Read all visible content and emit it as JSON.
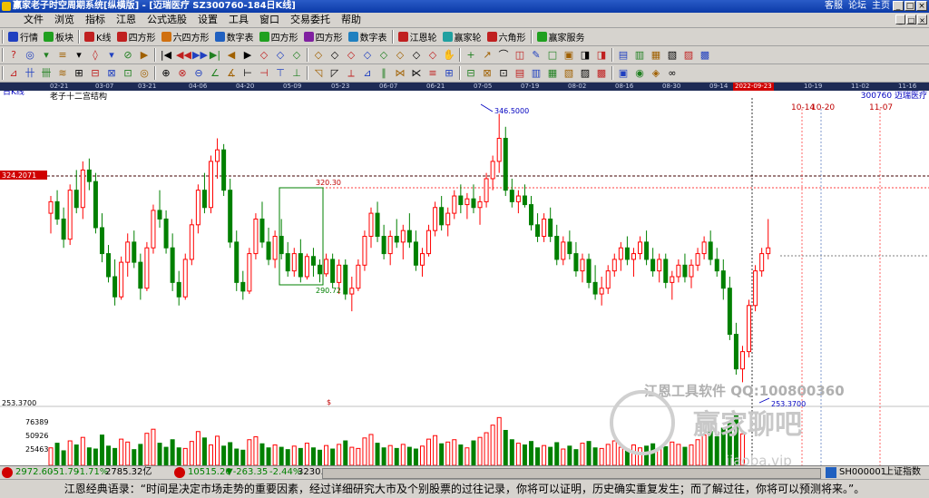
{
  "window": {
    "title": "赢家老子时空周期系统[纵横版] - [迈瑞医疗   SZ300760-184日K线]",
    "links": [
      "客服",
      "论坛",
      "主页"
    ],
    "buttons": [
      "_",
      "□",
      "×"
    ]
  },
  "menu": {
    "items": [
      "文件",
      "浏览",
      "指标",
      "江恩",
      "公式选股",
      "设置",
      "工具",
      "窗口",
      "交易委托",
      "帮助"
    ],
    "mdi_buttons": [
      "_",
      "□",
      "×"
    ]
  },
  "toolbar1": [
    {
      "label": "行情",
      "color": "#2040c0"
    },
    {
      "label": "板块",
      "color": "#20a020"
    },
    {
      "label": "K线",
      "color": "#c02020"
    },
    {
      "label": "四方形",
      "color": "#c02020"
    },
    {
      "label": "六四方形",
      "color": "#d07010"
    },
    {
      "label": "数字表",
      "color": "#2060c0"
    },
    {
      "label": "四方形",
      "color": "#20a020"
    },
    {
      "label": "四方形",
      "color": "#8020a0"
    },
    {
      "label": "数字表",
      "color": "#2080c0"
    },
    {
      "label": "江恩轮",
      "color": "#c02020"
    },
    {
      "label": "赢家轮",
      "color": "#20a0a0"
    },
    {
      "label": "六角形",
      "color": "#c02020"
    },
    {
      "label": "赢家服务",
      "color": "#20a020"
    }
  ],
  "toolbar2_icons": [
    "?",
    "◎",
    "▾",
    "≡",
    "▾",
    "◊",
    "▾",
    "⊘",
    "▶",
    "|◀",
    "◀◀",
    "▶▶",
    "▶|",
    "◀",
    "▶",
    "◇",
    "◇",
    "◇",
    "◇",
    "◇",
    "◇",
    "◇",
    "◇",
    "◇",
    "◇",
    "◇",
    "✋",
    "+",
    "↗",
    "⌒",
    "◫",
    "✎",
    "□",
    "▣",
    "◨",
    "◨",
    "▤",
    "▥",
    "▦",
    "▧",
    "▨",
    "▩"
  ],
  "toolbar3_icons": [
    "⊿",
    "卄",
    "卌",
    "≋",
    "⊞",
    "⊟",
    "⊠",
    "⊡",
    "◎",
    "⊕",
    "⊗",
    "⊖",
    "∠",
    "∡",
    "⊢",
    "⊣",
    "⊤",
    "⊥",
    "◹",
    "◸",
    "⟂",
    "⊿",
    "∥",
    "⋈",
    "⋉",
    "≡",
    "⊞",
    "⊟",
    "⊠",
    "⊡",
    "▤",
    "▥",
    "▦",
    "▧",
    "▨",
    "▩",
    "▣",
    "◉",
    "◈",
    "∞"
  ],
  "datebar": {
    "ticks": [
      "02-21",
      "03-07",
      "03-21",
      "04-06",
      "04-20",
      "05-09",
      "05-23",
      "06-07",
      "06-21",
      "07-05",
      "07-19",
      "08-02",
      "08-16",
      "08-30",
      "09-14",
      "10-19",
      "11-02",
      "11-16"
    ],
    "current": "2022-09-23"
  },
  "chart_data": {
    "type": "candlestick",
    "period_label": "日K线",
    "indicator_name": "老子十二宫结构",
    "stock_label": "300760  迈瑞医疗",
    "price_levels": {
      "top": "324.2071",
      "bottom": "253.3700"
    },
    "annotations": {
      "high": "346.5000",
      "low": "253.3700",
      "box_top": "320.30",
      "box_bottom": "290.72",
      "future_dates": [
        "10-14",
        "10-20",
        "11-07"
      ],
      "marker": "$"
    },
    "volume_levels": [
      "76389",
      "50926",
      "25463"
    ],
    "colors": {
      "up": "#ff0000",
      "down": "#008000",
      "bg": "#ffffff"
    },
    "candles": [
      {
        "o": 312,
        "h": 318,
        "l": 305,
        "c": 316
      },
      {
        "o": 316,
        "h": 320,
        "l": 308,
        "c": 310
      },
      {
        "o": 310,
        "h": 314,
        "l": 300,
        "c": 303
      },
      {
        "o": 303,
        "h": 322,
        "l": 301,
        "c": 320
      },
      {
        "o": 320,
        "h": 327,
        "l": 312,
        "c": 314
      },
      {
        "o": 314,
        "h": 330,
        "l": 310,
        "c": 327
      },
      {
        "o": 327,
        "h": 331,
        "l": 320,
        "c": 323
      },
      {
        "o": 323,
        "h": 326,
        "l": 305,
        "c": 307
      },
      {
        "o": 307,
        "h": 312,
        "l": 295,
        "c": 298
      },
      {
        "o": 298,
        "h": 301,
        "l": 288,
        "c": 290
      },
      {
        "o": 290,
        "h": 296,
        "l": 280,
        "c": 283
      },
      {
        "o": 283,
        "h": 297,
        "l": 282,
        "c": 295
      },
      {
        "o": 295,
        "h": 305,
        "l": 290,
        "c": 302
      },
      {
        "o": 302,
        "h": 306,
        "l": 293,
        "c": 295
      },
      {
        "o": 295,
        "h": 298,
        "l": 282,
        "c": 286
      },
      {
        "o": 286,
        "h": 302,
        "l": 285,
        "c": 300
      },
      {
        "o": 300,
        "h": 315,
        "l": 298,
        "c": 313
      },
      {
        "o": 313,
        "h": 320,
        "l": 307,
        "c": 310
      },
      {
        "o": 310,
        "h": 313,
        "l": 298,
        "c": 300
      },
      {
        "o": 300,
        "h": 305,
        "l": 285,
        "c": 288
      },
      {
        "o": 288,
        "h": 292,
        "l": 280,
        "c": 283
      },
      {
        "o": 283,
        "h": 298,
        "l": 282,
        "c": 296
      },
      {
        "o": 296,
        "h": 310,
        "l": 294,
        "c": 308
      },
      {
        "o": 308,
        "h": 322,
        "l": 305,
        "c": 320
      },
      {
        "o": 320,
        "h": 326,
        "l": 312,
        "c": 314
      },
      {
        "o": 314,
        "h": 332,
        "l": 312,
        "c": 330
      },
      {
        "o": 330,
        "h": 338,
        "l": 324,
        "c": 334
      },
      {
        "o": 334,
        "h": 336,
        "l": 318,
        "c": 320
      },
      {
        "o": 320,
        "h": 324,
        "l": 300,
        "c": 302
      },
      {
        "o": 302,
        "h": 306,
        "l": 285,
        "c": 288
      },
      {
        "o": 288,
        "h": 292,
        "l": 282,
        "c": 285
      },
      {
        "o": 285,
        "h": 300,
        "l": 284,
        "c": 298
      },
      {
        "o": 298,
        "h": 312,
        "l": 296,
        "c": 310
      },
      {
        "o": 310,
        "h": 316,
        "l": 300,
        "c": 302
      },
      {
        "o": 302,
        "h": 307,
        "l": 294,
        "c": 296
      },
      {
        "o": 296,
        "h": 306,
        "l": 293,
        "c": 304
      },
      {
        "o": 304,
        "h": 310,
        "l": 296,
        "c": 298
      },
      {
        "o": 298,
        "h": 302,
        "l": 290,
        "c": 292
      },
      {
        "o": 292,
        "h": 300,
        "l": 290,
        "c": 298
      },
      {
        "o": 298,
        "h": 303,
        "l": 288,
        "c": 290
      },
      {
        "o": 290,
        "h": 298,
        "l": 289,
        "c": 297
      },
      {
        "o": 297,
        "h": 300,
        "l": 290,
        "c": 294
      },
      {
        "o": 294,
        "h": 296,
        "l": 288,
        "c": 291
      },
      {
        "o": 291,
        "h": 298,
        "l": 290,
        "c": 296
      },
      {
        "o": 296,
        "h": 298,
        "l": 286,
        "c": 288
      },
      {
        "o": 288,
        "h": 296,
        "l": 284,
        "c": 294
      },
      {
        "o": 294,
        "h": 296,
        "l": 282,
        "c": 284
      },
      {
        "o": 284,
        "h": 290,
        "l": 278,
        "c": 286
      },
      {
        "o": 286,
        "h": 296,
        "l": 285,
        "c": 294
      },
      {
        "o": 294,
        "h": 306,
        "l": 292,
        "c": 304
      },
      {
        "o": 304,
        "h": 314,
        "l": 300,
        "c": 312
      },
      {
        "o": 312,
        "h": 316,
        "l": 302,
        "c": 304
      },
      {
        "o": 304,
        "h": 308,
        "l": 296,
        "c": 298
      },
      {
        "o": 298,
        "h": 306,
        "l": 294,
        "c": 304
      },
      {
        "o": 304,
        "h": 310,
        "l": 300,
        "c": 302
      },
      {
        "o": 302,
        "h": 308,
        "l": 296,
        "c": 306
      },
      {
        "o": 306,
        "h": 312,
        "l": 300,
        "c": 302
      },
      {
        "o": 302,
        "h": 306,
        "l": 292,
        "c": 294
      },
      {
        "o": 294,
        "h": 300,
        "l": 290,
        "c": 298
      },
      {
        "o": 298,
        "h": 308,
        "l": 297,
        "c": 306
      },
      {
        "o": 306,
        "h": 316,
        "l": 304,
        "c": 314
      },
      {
        "o": 314,
        "h": 318,
        "l": 306,
        "c": 308
      },
      {
        "o": 308,
        "h": 314,
        "l": 304,
        "c": 312
      },
      {
        "o": 312,
        "h": 320,
        "l": 310,
        "c": 318
      },
      {
        "o": 318,
        "h": 322,
        "l": 312,
        "c": 315
      },
      {
        "o": 315,
        "h": 319,
        "l": 310,
        "c": 317
      },
      {
        "o": 317,
        "h": 322,
        "l": 312,
        "c": 314
      },
      {
        "o": 314,
        "h": 318,
        "l": 308,
        "c": 316
      },
      {
        "o": 316,
        "h": 326,
        "l": 314,
        "c": 324
      },
      {
        "o": 324,
        "h": 332,
        "l": 320,
        "c": 330
      },
      {
        "o": 330,
        "h": 346.5,
        "l": 326,
        "c": 338
      },
      {
        "o": 338,
        "h": 342,
        "l": 318,
        "c": 320
      },
      {
        "o": 320,
        "h": 324,
        "l": 314,
        "c": 316
      },
      {
        "o": 316,
        "h": 320,
        "l": 312,
        "c": 318
      },
      {
        "o": 318,
        "h": 322,
        "l": 314,
        "c": 315
      },
      {
        "o": 315,
        "h": 318,
        "l": 306,
        "c": 308
      },
      {
        "o": 308,
        "h": 312,
        "l": 302,
        "c": 304
      },
      {
        "o": 304,
        "h": 312,
        "l": 302,
        "c": 310
      },
      {
        "o": 310,
        "h": 314,
        "l": 302,
        "c": 304
      },
      {
        "o": 304,
        "h": 308,
        "l": 294,
        "c": 296
      },
      {
        "o": 296,
        "h": 304,
        "l": 294,
        "c": 302
      },
      {
        "o": 302,
        "h": 306,
        "l": 296,
        "c": 298
      },
      {
        "o": 298,
        "h": 302,
        "l": 290,
        "c": 292
      },
      {
        "o": 292,
        "h": 298,
        "l": 288,
        "c": 296
      },
      {
        "o": 296,
        "h": 298,
        "l": 286,
        "c": 288
      },
      {
        "o": 288,
        "h": 294,
        "l": 282,
        "c": 284
      },
      {
        "o": 284,
        "h": 290,
        "l": 280,
        "c": 286
      },
      {
        "o": 286,
        "h": 294,
        "l": 284,
        "c": 292
      },
      {
        "o": 292,
        "h": 298,
        "l": 290,
        "c": 296
      },
      {
        "o": 296,
        "h": 302,
        "l": 292,
        "c": 300
      },
      {
        "o": 300,
        "h": 304,
        "l": 294,
        "c": 296
      },
      {
        "o": 296,
        "h": 300,
        "l": 290,
        "c": 298
      },
      {
        "o": 298,
        "h": 304,
        "l": 296,
        "c": 302
      },
      {
        "o": 302,
        "h": 306,
        "l": 294,
        "c": 296
      },
      {
        "o": 296,
        "h": 300,
        "l": 290,
        "c": 292
      },
      {
        "o": 292,
        "h": 298,
        "l": 288,
        "c": 296
      },
      {
        "o": 296,
        "h": 298,
        "l": 286,
        "c": 288
      },
      {
        "o": 288,
        "h": 292,
        "l": 282,
        "c": 290
      },
      {
        "o": 290,
        "h": 296,
        "l": 288,
        "c": 294
      },
      {
        "o": 294,
        "h": 298,
        "l": 288,
        "c": 290
      },
      {
        "o": 290,
        "h": 296,
        "l": 286,
        "c": 294
      },
      {
        "o": 294,
        "h": 300,
        "l": 292,
        "c": 298
      },
      {
        "o": 298,
        "h": 304,
        "l": 296,
        "c": 302
      },
      {
        "o": 302,
        "h": 306,
        "l": 294,
        "c": 296
      },
      {
        "o": 296,
        "h": 300,
        "l": 290,
        "c": 292
      },
      {
        "o": 292,
        "h": 296,
        "l": 282,
        "c": 286
      },
      {
        "o": 286,
        "h": 290,
        "l": 268,
        "c": 270
      },
      {
        "o": 270,
        "h": 274,
        "l": 256,
        "c": 258
      },
      {
        "o": 258,
        "h": 266,
        "l": 253.37,
        "c": 264
      },
      {
        "o": 264,
        "h": 282,
        "l": 262,
        "c": 280
      },
      {
        "o": 280,
        "h": 294,
        "l": 278,
        "c": 292
      },
      {
        "o": 292,
        "h": 300,
        "l": 290,
        "c": 298
      },
      {
        "o": 298,
        "h": 310,
        "l": 296,
        "c": 300
      }
    ],
    "volumes": [
      30,
      38,
      25,
      42,
      35,
      48,
      30,
      28,
      52,
      33,
      29,
      45,
      40,
      27,
      36,
      55,
      62,
      38,
      31,
      44,
      30,
      29,
      41,
      58,
      47,
      35,
      50,
      33,
      39,
      28,
      26,
      44,
      49,
      37,
      30,
      35,
      31,
      27,
      33,
      29,
      38,
      30,
      26,
      34,
      28,
      36,
      42,
      31,
      29,
      47,
      53,
      38,
      30,
      34,
      29,
      36,
      31,
      28,
      33,
      45,
      51,
      37,
      40,
      44,
      35,
      30,
      42,
      48,
      56,
      69,
      82,
      60,
      44,
      38,
      35,
      41,
      30,
      34,
      31,
      39,
      28,
      33,
      27,
      38,
      41,
      30,
      29,
      36,
      42,
      31,
      28,
      35,
      30,
      33,
      37,
      29,
      32,
      40,
      36,
      31,
      35,
      44,
      52,
      58,
      49,
      64,
      72,
      88,
      54
    ]
  },
  "statusbar": {
    "sh_index": "2972.60",
    "sh_change": "-51.79",
    "sh_pct": "-1.71%",
    "sh_amount": "2785.32亿",
    "sz_index": "10515.26",
    "sz_change": "▼-263.35",
    "sz_pct": "-2.44%",
    "sz_amount": "3230.",
    "index_code": "SH000001",
    "index_name": "上证指数"
  },
  "watermark": {
    "line1": "江恩工具软件 QQ:100800360",
    "line2": "赢家聊吧",
    "line3": "jiaoba.vip"
  },
  "quote": "江恩经典语录：“时间是决定市场走势的重要因素，经过详细研究大市及个别股票的过往记录，你将可以证明，历史确实重复发生；而了解过往，你将可以预测将来。”。"
}
